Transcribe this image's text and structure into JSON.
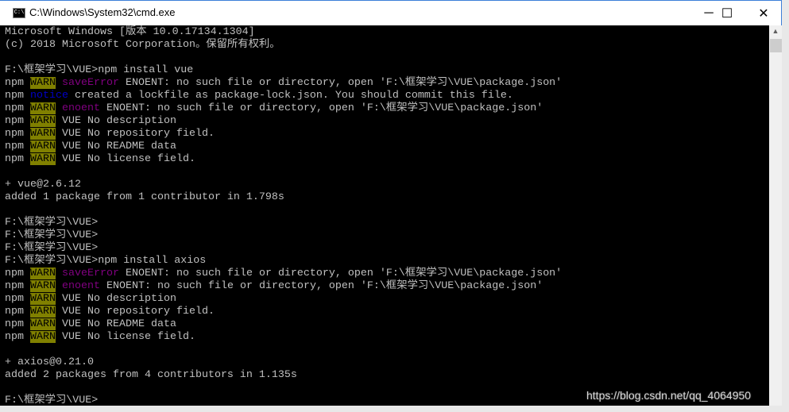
{
  "window": {
    "title": "C:\\Windows\\System32\\cmd.exe",
    "app_icon": "C:\\",
    "minimize": "─",
    "maximize": "☐",
    "close": "✕"
  },
  "scrollbar": {
    "up_arrow": "▲"
  },
  "colors": {
    "warn_bg": "#808000",
    "magenta": "#800080",
    "blue": "#0000c8",
    "text": "#c0c0c0",
    "background": "#000000"
  },
  "console": {
    "lines": [
      [
        [
          "Microsoft Windows [版本 10.0.17134.1304]",
          ""
        ]
      ],
      [
        [
          "(c) 2018 Microsoft Corporation。保留所有权利。",
          ""
        ]
      ],
      [],
      [
        [
          "F:\\框架学习\\VUE>npm install vue",
          ""
        ]
      ],
      [
        [
          "npm ",
          ""
        ],
        [
          "WARN",
          "warn"
        ],
        [
          " ",
          ""
        ],
        [
          "saveError",
          "magenta"
        ],
        [
          " ENOENT: no such file or directory, open 'F:\\框架学习\\VUE\\package.json'",
          ""
        ]
      ],
      [
        [
          "npm ",
          ""
        ],
        [
          "notice",
          "blue"
        ],
        [
          " created a lockfile as package-lock.json. You should commit this file.",
          ""
        ]
      ],
      [
        [
          "npm ",
          ""
        ],
        [
          "WARN",
          "warn"
        ],
        [
          " ",
          ""
        ],
        [
          "enoent",
          "magenta"
        ],
        [
          " ENOENT: no such file or directory, open 'F:\\框架学习\\VUE\\package.json'",
          ""
        ]
      ],
      [
        [
          "npm ",
          ""
        ],
        [
          "WARN",
          "warn"
        ],
        [
          " VUE No description",
          ""
        ]
      ],
      [
        [
          "npm ",
          ""
        ],
        [
          "WARN",
          "warn"
        ],
        [
          " VUE No repository field.",
          ""
        ]
      ],
      [
        [
          "npm ",
          ""
        ],
        [
          "WARN",
          "warn"
        ],
        [
          " VUE No README data",
          ""
        ]
      ],
      [
        [
          "npm ",
          ""
        ],
        [
          "WARN",
          "warn"
        ],
        [
          " VUE No license field.",
          ""
        ]
      ],
      [],
      [
        [
          "+ vue@2.6.12",
          ""
        ]
      ],
      [
        [
          "added 1 package from 1 contributor in 1.798s",
          ""
        ]
      ],
      [],
      [
        [
          "F:\\框架学习\\VUE>",
          ""
        ]
      ],
      [
        [
          "F:\\框架学习\\VUE>",
          ""
        ]
      ],
      [
        [
          "F:\\框架学习\\VUE>",
          ""
        ]
      ],
      [
        [
          "F:\\框架学习\\VUE>npm install axios",
          ""
        ]
      ],
      [
        [
          "npm ",
          ""
        ],
        [
          "WARN",
          "warn"
        ],
        [
          " ",
          ""
        ],
        [
          "saveError",
          "magenta"
        ],
        [
          " ENOENT: no such file or directory, open 'F:\\框架学习\\VUE\\package.json'",
          ""
        ]
      ],
      [
        [
          "npm ",
          ""
        ],
        [
          "WARN",
          "warn"
        ],
        [
          " ",
          ""
        ],
        [
          "enoent",
          "magenta"
        ],
        [
          " ENOENT: no such file or directory, open 'F:\\框架学习\\VUE\\package.json'",
          ""
        ]
      ],
      [
        [
          "npm ",
          ""
        ],
        [
          "WARN",
          "warn"
        ],
        [
          " VUE No description",
          ""
        ]
      ],
      [
        [
          "npm ",
          ""
        ],
        [
          "WARN",
          "warn"
        ],
        [
          " VUE No repository field.",
          ""
        ]
      ],
      [
        [
          "npm ",
          ""
        ],
        [
          "WARN",
          "warn"
        ],
        [
          " VUE No README data",
          ""
        ]
      ],
      [
        [
          "npm ",
          ""
        ],
        [
          "WARN",
          "warn"
        ],
        [
          " VUE No license field.",
          ""
        ]
      ],
      [],
      [
        [
          "+ axios@0.21.0",
          ""
        ]
      ],
      [
        [
          "added 2 packages from 4 contributors in 1.135s",
          ""
        ]
      ],
      [],
      [
        [
          "F:\\框架学习\\VUE>",
          ""
        ]
      ]
    ]
  },
  "watermark": "https://blog.csdn.net/qq_4064950"
}
